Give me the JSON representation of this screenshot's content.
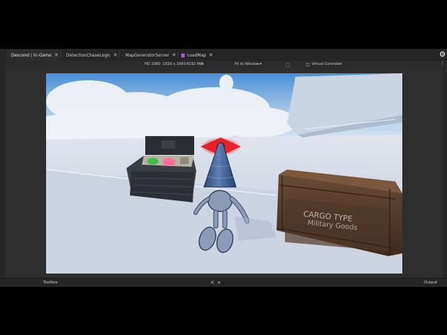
{
  "tabs": [
    {
      "label": "Descend | In-Game",
      "active": true
    },
    {
      "label": "DetectionChaseLogic",
      "active": false
    },
    {
      "label": "MapGeneratorServer",
      "active": false
    },
    {
      "label": "LoadMap",
      "active": false
    }
  ],
  "devicebar": {
    "device": "HD 1080",
    "resolution": "1920 x 1080",
    "memory": "8192 MB",
    "fit": "Fit to Window",
    "virtual_controller": "Virtual Controller"
  },
  "viewport": {
    "crate_line1": "CARGO TYPE",
    "crate_line2": "Military Goods"
  },
  "bottom": {
    "toolbox": "Toolbox",
    "output": "Output"
  },
  "colors": {
    "script_icon": "#a05cd8",
    "eye_red": "#e8202a",
    "cone_blue": "#3f5f8f"
  }
}
